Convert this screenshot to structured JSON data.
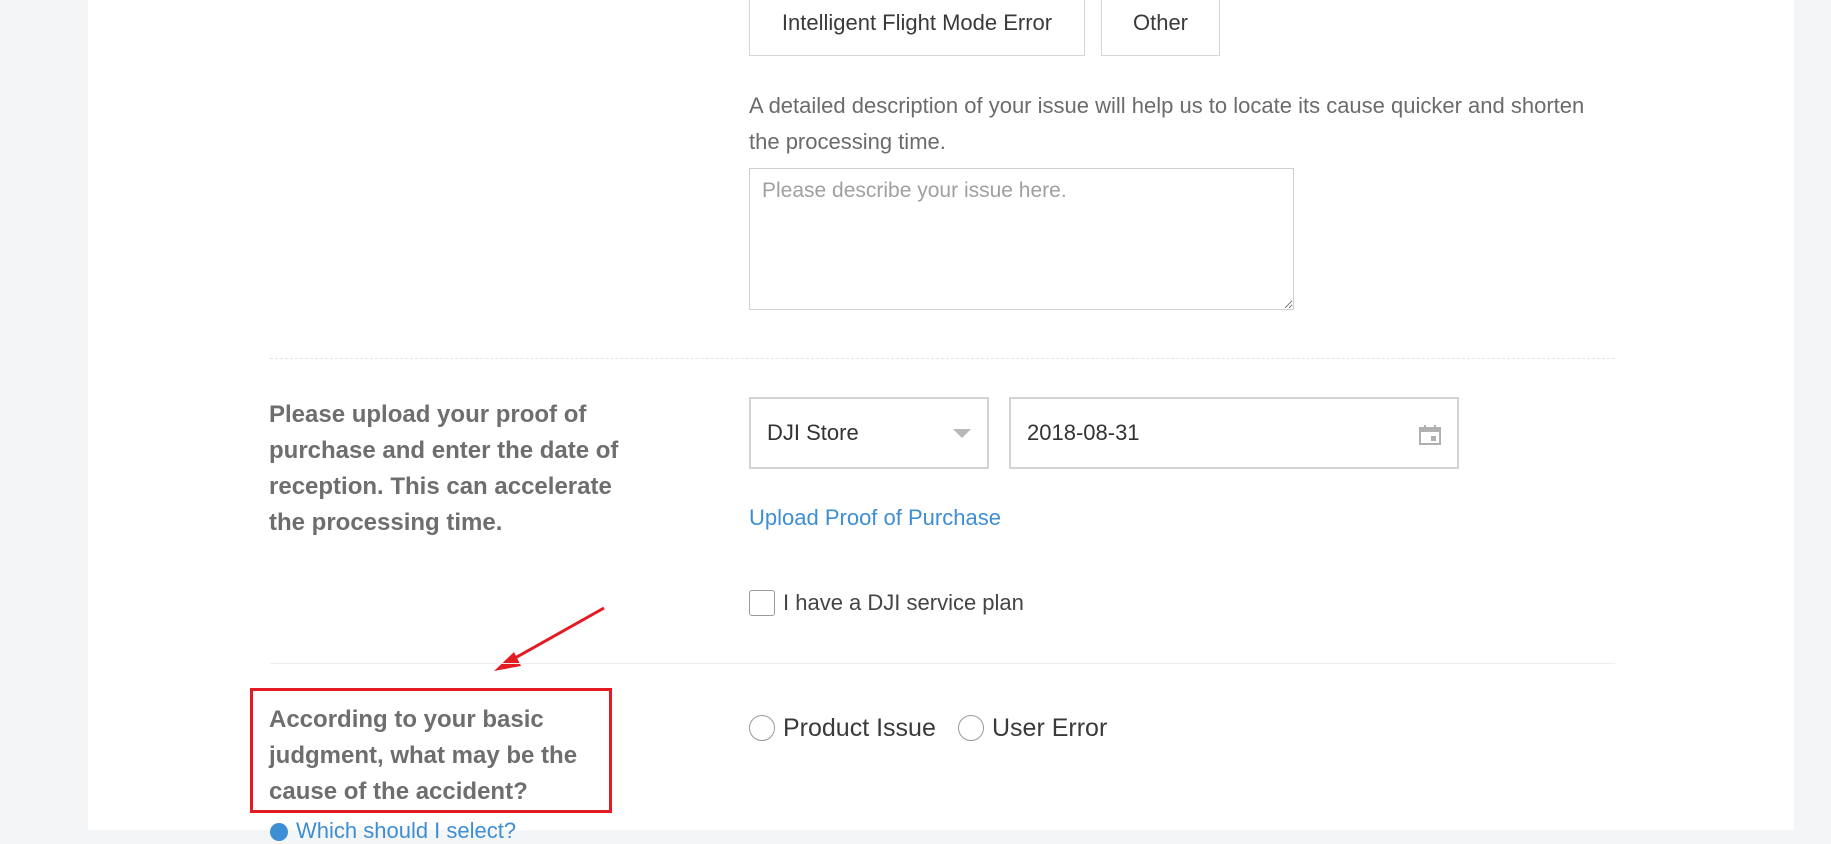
{
  "issue_types": {
    "intelligent_flight": "Intelligent Flight Mode Error",
    "other": "Other"
  },
  "description": {
    "helper_line1": "A detailed description of your issue will help us to locate its cause quicker and shorten",
    "helper_line2": "the processing time.",
    "placeholder": "Please describe your issue here."
  },
  "purchase": {
    "label": "Please upload your proof of purchase and enter the date of reception. This can accelerate the processing time.",
    "store_selected": "DJI Store",
    "date_value": "2018-08-31",
    "upload_link": "Upload Proof of Purchase",
    "service_plan_label": "I have a DJI service plan"
  },
  "cause": {
    "label": "According to your basic judgment, what may be the cause of the accident?",
    "option_product": "Product Issue",
    "option_user": "User Error",
    "why_link": "Which should I select?"
  },
  "colors": {
    "annotation_red": "#e21c22",
    "link_blue": "#3d8ed4"
  }
}
